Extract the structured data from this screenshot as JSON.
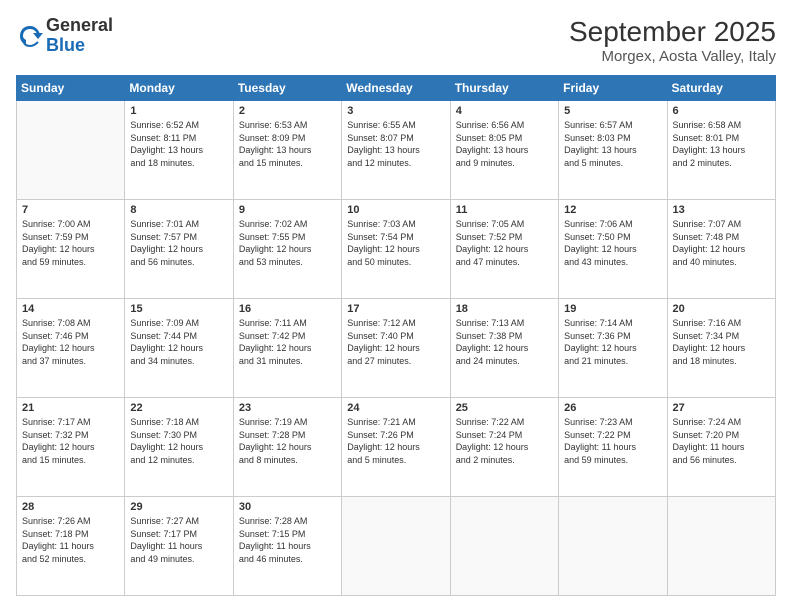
{
  "logo": {
    "general": "General",
    "blue": "Blue"
  },
  "title": "September 2025",
  "location": "Morgex, Aosta Valley, Italy",
  "weekdays": [
    "Sunday",
    "Monday",
    "Tuesday",
    "Wednesday",
    "Thursday",
    "Friday",
    "Saturday"
  ],
  "weeks": [
    [
      {
        "day": "",
        "info": ""
      },
      {
        "day": "1",
        "info": "Sunrise: 6:52 AM\nSunset: 8:11 PM\nDaylight: 13 hours\nand 18 minutes."
      },
      {
        "day": "2",
        "info": "Sunrise: 6:53 AM\nSunset: 8:09 PM\nDaylight: 13 hours\nand 15 minutes."
      },
      {
        "day": "3",
        "info": "Sunrise: 6:55 AM\nSunset: 8:07 PM\nDaylight: 13 hours\nand 12 minutes."
      },
      {
        "day": "4",
        "info": "Sunrise: 6:56 AM\nSunset: 8:05 PM\nDaylight: 13 hours\nand 9 minutes."
      },
      {
        "day": "5",
        "info": "Sunrise: 6:57 AM\nSunset: 8:03 PM\nDaylight: 13 hours\nand 5 minutes."
      },
      {
        "day": "6",
        "info": "Sunrise: 6:58 AM\nSunset: 8:01 PM\nDaylight: 13 hours\nand 2 minutes."
      }
    ],
    [
      {
        "day": "7",
        "info": "Sunrise: 7:00 AM\nSunset: 7:59 PM\nDaylight: 12 hours\nand 59 minutes."
      },
      {
        "day": "8",
        "info": "Sunrise: 7:01 AM\nSunset: 7:57 PM\nDaylight: 12 hours\nand 56 minutes."
      },
      {
        "day": "9",
        "info": "Sunrise: 7:02 AM\nSunset: 7:55 PM\nDaylight: 12 hours\nand 53 minutes."
      },
      {
        "day": "10",
        "info": "Sunrise: 7:03 AM\nSunset: 7:54 PM\nDaylight: 12 hours\nand 50 minutes."
      },
      {
        "day": "11",
        "info": "Sunrise: 7:05 AM\nSunset: 7:52 PM\nDaylight: 12 hours\nand 47 minutes."
      },
      {
        "day": "12",
        "info": "Sunrise: 7:06 AM\nSunset: 7:50 PM\nDaylight: 12 hours\nand 43 minutes."
      },
      {
        "day": "13",
        "info": "Sunrise: 7:07 AM\nSunset: 7:48 PM\nDaylight: 12 hours\nand 40 minutes."
      }
    ],
    [
      {
        "day": "14",
        "info": "Sunrise: 7:08 AM\nSunset: 7:46 PM\nDaylight: 12 hours\nand 37 minutes."
      },
      {
        "day": "15",
        "info": "Sunrise: 7:09 AM\nSunset: 7:44 PM\nDaylight: 12 hours\nand 34 minutes."
      },
      {
        "day": "16",
        "info": "Sunrise: 7:11 AM\nSunset: 7:42 PM\nDaylight: 12 hours\nand 31 minutes."
      },
      {
        "day": "17",
        "info": "Sunrise: 7:12 AM\nSunset: 7:40 PM\nDaylight: 12 hours\nand 27 minutes."
      },
      {
        "day": "18",
        "info": "Sunrise: 7:13 AM\nSunset: 7:38 PM\nDaylight: 12 hours\nand 24 minutes."
      },
      {
        "day": "19",
        "info": "Sunrise: 7:14 AM\nSunset: 7:36 PM\nDaylight: 12 hours\nand 21 minutes."
      },
      {
        "day": "20",
        "info": "Sunrise: 7:16 AM\nSunset: 7:34 PM\nDaylight: 12 hours\nand 18 minutes."
      }
    ],
    [
      {
        "day": "21",
        "info": "Sunrise: 7:17 AM\nSunset: 7:32 PM\nDaylight: 12 hours\nand 15 minutes."
      },
      {
        "day": "22",
        "info": "Sunrise: 7:18 AM\nSunset: 7:30 PM\nDaylight: 12 hours\nand 12 minutes."
      },
      {
        "day": "23",
        "info": "Sunrise: 7:19 AM\nSunset: 7:28 PM\nDaylight: 12 hours\nand 8 minutes."
      },
      {
        "day": "24",
        "info": "Sunrise: 7:21 AM\nSunset: 7:26 PM\nDaylight: 12 hours\nand 5 minutes."
      },
      {
        "day": "25",
        "info": "Sunrise: 7:22 AM\nSunset: 7:24 PM\nDaylight: 12 hours\nand 2 minutes."
      },
      {
        "day": "26",
        "info": "Sunrise: 7:23 AM\nSunset: 7:22 PM\nDaylight: 11 hours\nand 59 minutes."
      },
      {
        "day": "27",
        "info": "Sunrise: 7:24 AM\nSunset: 7:20 PM\nDaylight: 11 hours\nand 56 minutes."
      }
    ],
    [
      {
        "day": "28",
        "info": "Sunrise: 7:26 AM\nSunset: 7:18 PM\nDaylight: 11 hours\nand 52 minutes."
      },
      {
        "day": "29",
        "info": "Sunrise: 7:27 AM\nSunset: 7:17 PM\nDaylight: 11 hours\nand 49 minutes."
      },
      {
        "day": "30",
        "info": "Sunrise: 7:28 AM\nSunset: 7:15 PM\nDaylight: 11 hours\nand 46 minutes."
      },
      {
        "day": "",
        "info": ""
      },
      {
        "day": "",
        "info": ""
      },
      {
        "day": "",
        "info": ""
      },
      {
        "day": "",
        "info": ""
      }
    ]
  ]
}
